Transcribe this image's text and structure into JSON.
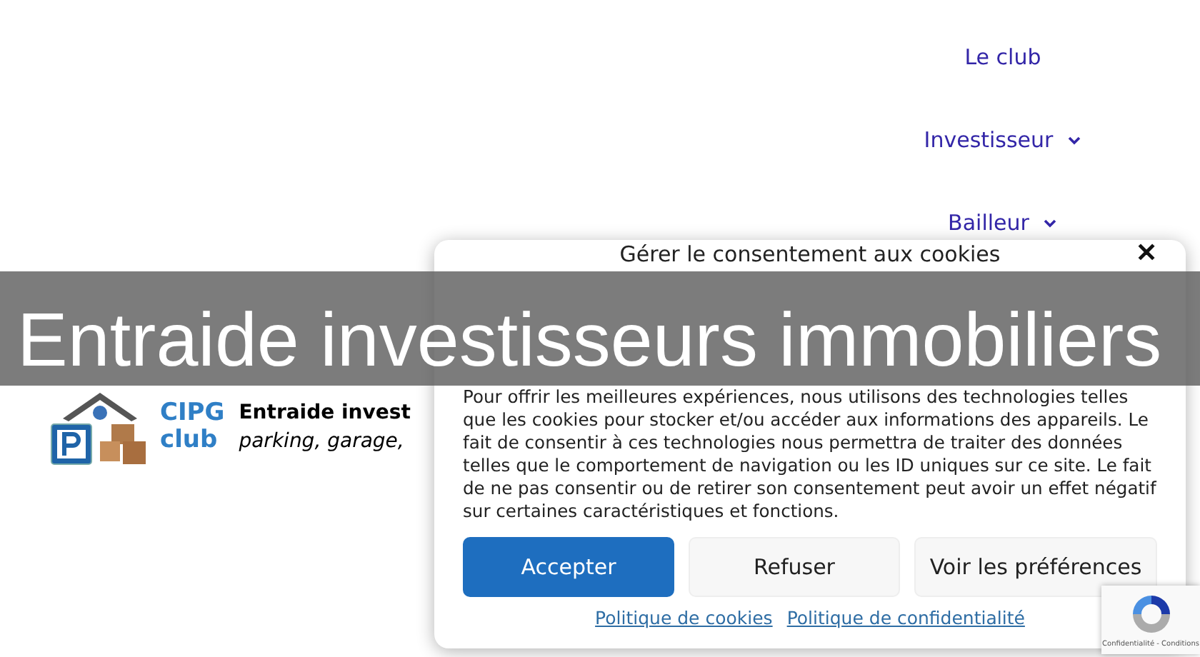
{
  "nav": {
    "items": [
      {
        "label": "Le club",
        "has_submenu": false
      },
      {
        "label": "Investisseur",
        "has_submenu": true
      },
      {
        "label": "Bailleur",
        "has_submenu": true
      }
    ]
  },
  "logo": {
    "line_1": "CIPG",
    "line_2": "club"
  },
  "site": {
    "name": "Entraide invest",
    "tagline": "parking, garage,"
  },
  "banner": {
    "title": "Entraide investisseurs immobiliers"
  },
  "cookie_dialog": {
    "title": "Gérer le consentement aux cookies",
    "close": "✕",
    "text": "Pour offrir les meilleures expériences, nous utilisons des technologies telles que les cookies pour stocker et/ou accéder aux informations des appareils. Le fait de consentir à ces technologies nous permettra de traiter des données telles que le comportement de navigation ou les ID uniques sur ce site. Le fait de ne pas consentir ou de retirer son consentement peut avoir un effet négatif sur certaines caractéristiques et fonctions.",
    "buttons": [
      {
        "label": "Accepter",
        "kind": "primary"
      },
      {
        "label": "Refuser",
        "kind": "secondary"
      },
      {
        "label": "Voir les préférences",
        "kind": "secondary"
      }
    ],
    "links": [
      "Politique de cookies",
      "Politique de confidentialité"
    ]
  },
  "recaptcha": {
    "text": "Confidentialité - Conditions"
  }
}
